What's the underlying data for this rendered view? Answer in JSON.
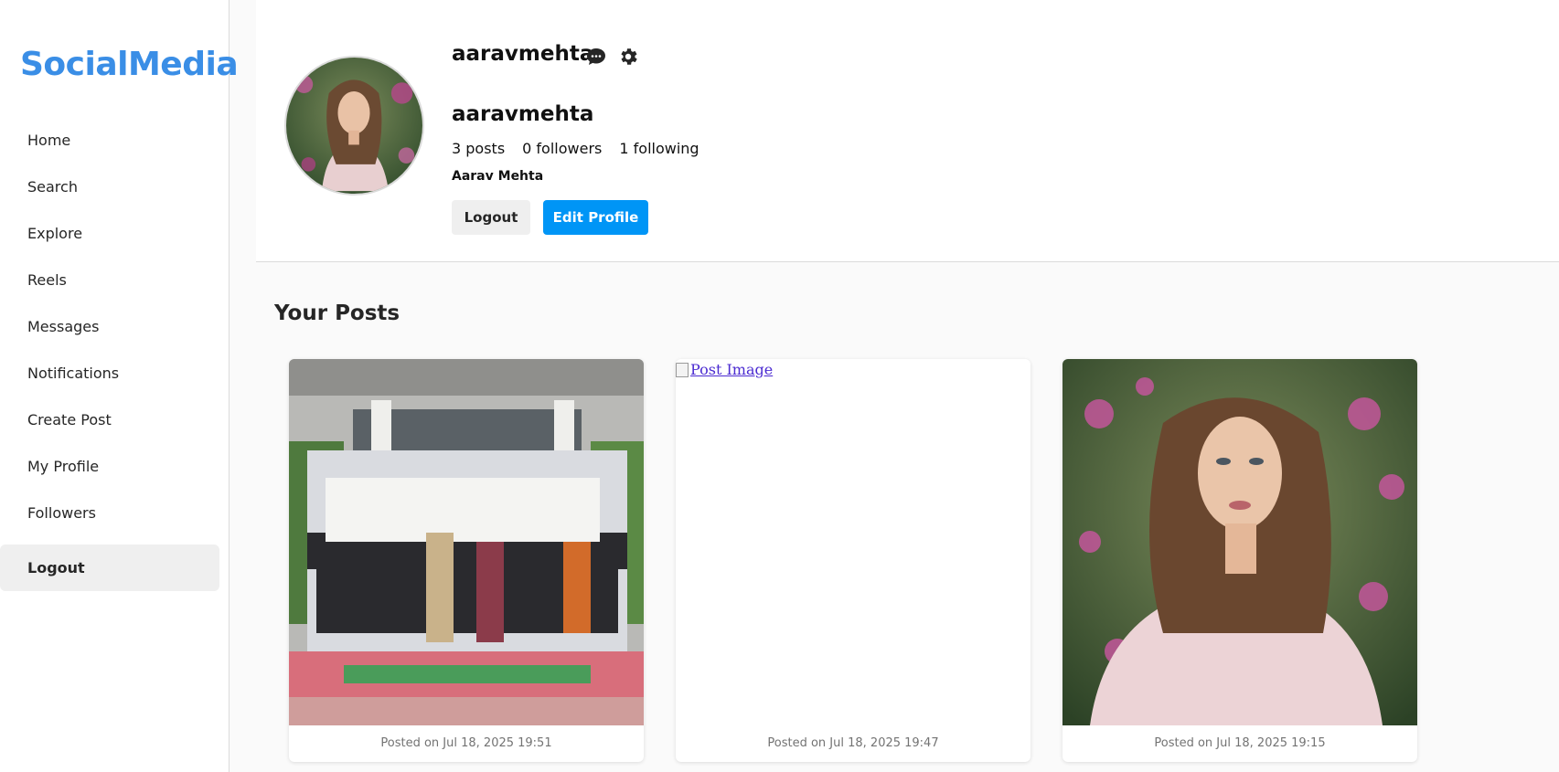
{
  "app": {
    "logo": "SocialMedia"
  },
  "sidebar": {
    "items": [
      {
        "label": "Home"
      },
      {
        "label": "Search"
      },
      {
        "label": "Explore"
      },
      {
        "label": "Reels"
      },
      {
        "label": "Messages"
      },
      {
        "label": "Notifications"
      },
      {
        "label": "Create Post"
      },
      {
        "label": "My Profile"
      },
      {
        "label": "Followers"
      }
    ],
    "logout_label": "Logout"
  },
  "profile": {
    "username_top": "aaravmehta",
    "username": "aaravmehta",
    "posts_count": "3 posts",
    "followers": "0 followers",
    "following": "1 following",
    "full_name": "Aarav Mehta",
    "logout_label": "Logout",
    "edit_label": "Edit Profile",
    "message_icon": "chat-bubble-icon",
    "settings_icon": "gear-icon"
  },
  "posts_section": {
    "title": "Your Posts",
    "posts": [
      {
        "alt": "",
        "date": "Posted on Jul 18, 2025 19:51"
      },
      {
        "alt": "Post Image",
        "date": "Posted on Jul 18, 2025 19:47"
      },
      {
        "alt": "",
        "date": "Posted on Jul 18, 2025 19:15"
      }
    ]
  },
  "colors": {
    "accent": "#0095f6",
    "logo": "#3a8ee6",
    "link": "#4b2bd1"
  }
}
